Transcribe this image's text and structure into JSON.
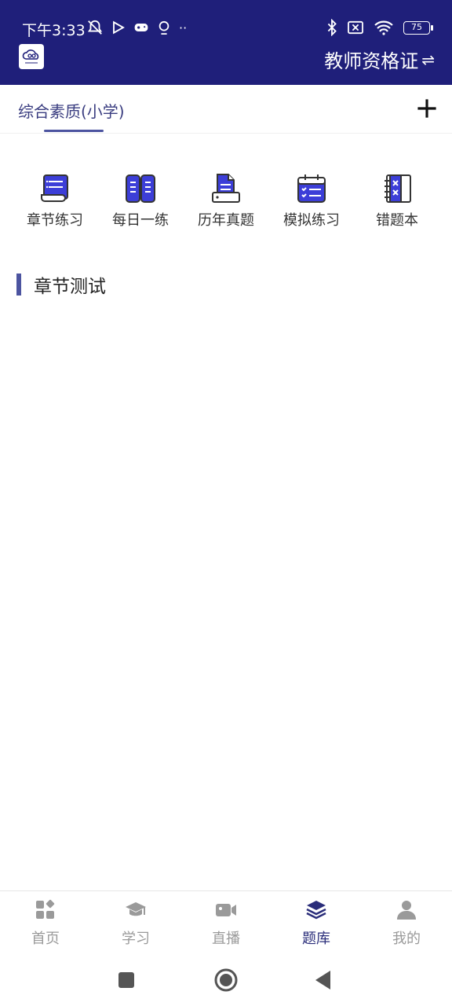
{
  "status": {
    "time": "下午3:33",
    "battery": "75"
  },
  "header": {
    "title": "教师资格证",
    "switch_glyph": "⇌"
  },
  "tabs": [
    {
      "label": "综合素质(小学)",
      "active": true
    }
  ],
  "shortcuts": [
    {
      "label": "章节练习",
      "icon": "chapter-practice-icon"
    },
    {
      "label": "每日一练",
      "icon": "daily-practice-icon"
    },
    {
      "label": "历年真题",
      "icon": "past-exams-icon"
    },
    {
      "label": "模拟练习",
      "icon": "mock-exam-icon"
    },
    {
      "label": "错题本",
      "icon": "wrong-questions-icon"
    }
  ],
  "section": {
    "title": "章节测试"
  },
  "bottom_nav": [
    {
      "label": "首页",
      "icon": "home-grid-icon",
      "active": false
    },
    {
      "label": "学习",
      "icon": "graduation-cap-icon",
      "active": false
    },
    {
      "label": "直播",
      "icon": "video-camera-icon",
      "active": false
    },
    {
      "label": "题库",
      "icon": "layers-icon",
      "active": true
    },
    {
      "label": "我的",
      "icon": "person-icon",
      "active": false
    }
  ],
  "colors": {
    "header_bg": "#1f1f7a",
    "accent": "#4c54a0",
    "icon_fill": "#3c3ed8",
    "nav_active": "#2a2d7a",
    "nav_inactive": "#9a9a9a"
  }
}
